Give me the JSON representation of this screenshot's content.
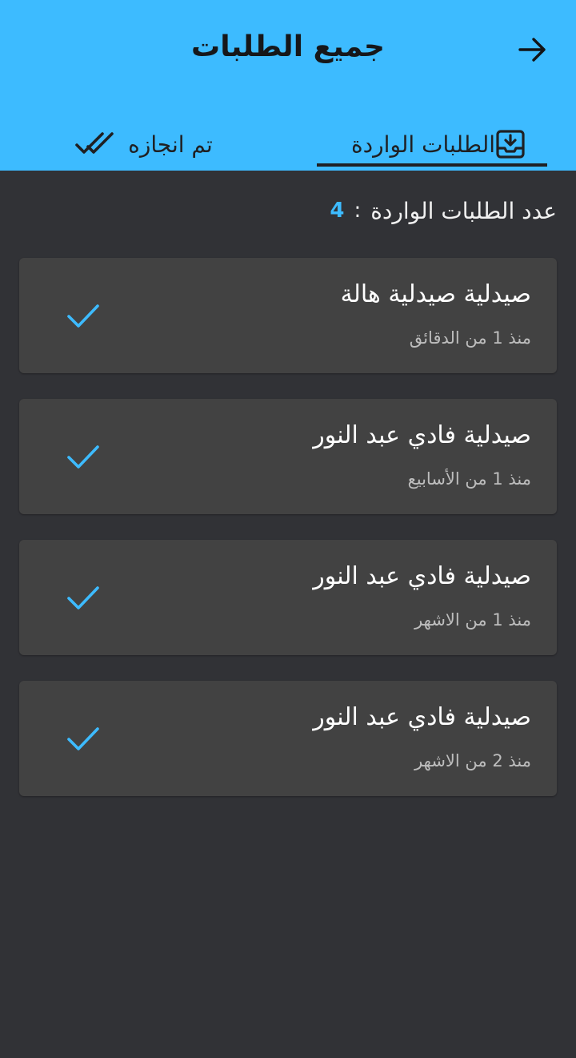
{
  "header": {
    "title": "جميع الطلبات",
    "back_icon": "arrow-right-icon"
  },
  "tabs": [
    {
      "label": "الطلبات الواردة",
      "icon": "inbox-download-icon",
      "active": true
    },
    {
      "label": "تم انجازه",
      "icon": "double-check-icon",
      "active": false
    }
  ],
  "summary": {
    "label": "عدد الطلبات الواردة",
    "separator": ":",
    "count": "4"
  },
  "orders": [
    {
      "name": "صيدلية  صيدلية هالة",
      "time": "منذ  1  من  الدقائق"
    },
    {
      "name": "صيدلية فادي عبد النور",
      "time": "منذ  1  من الأسابيع"
    },
    {
      "name": "صيدلية فادي عبد النور",
      "time": "منذ  1  من الاشهر"
    },
    {
      "name": "صيدلية فادي عبد النور",
      "time": "منذ  2  من الاشهر"
    }
  ],
  "colors": {
    "header_bg": "#3dbbff",
    "page_bg": "#313236",
    "card_bg": "#424242",
    "accent": "#3dbbff"
  }
}
